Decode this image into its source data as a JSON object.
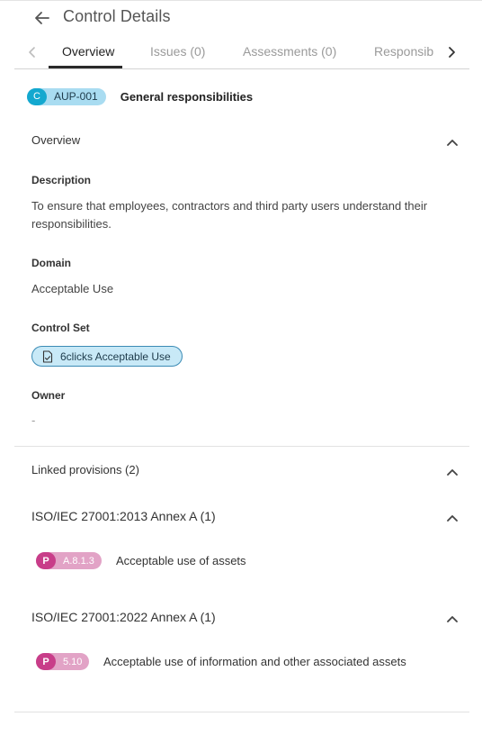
{
  "header": {
    "title": "Control Details"
  },
  "tabs": [
    {
      "label": "Overview"
    },
    {
      "label": "Issues (0)"
    },
    {
      "label": "Assessments (0)"
    },
    {
      "label": "Responsib"
    }
  ],
  "control": {
    "type_letter": "C",
    "code": "AUP-001",
    "name": "General responsibilities"
  },
  "overview": {
    "title": "Overview",
    "description_label": "Description",
    "description_line1": "To ensure that employees, contractors and third party users understand their",
    "description_line2": "responsibilities.",
    "domain_label": "Domain",
    "domain_value": "Acceptable Use",
    "control_set_label": "Control Set",
    "control_set_value": "6clicks Acceptable Use",
    "owner_label": "Owner",
    "owner_value": "-"
  },
  "linked": {
    "title": "Linked provisions (2)",
    "groups": [
      {
        "title": "ISO/IEC 27001:2013 Annex A (1)",
        "provisions": [
          {
            "letter": "P",
            "code": "A.8.1.3",
            "text": "Acceptable use of assets"
          }
        ]
      },
      {
        "title": "ISO/IEC 27001:2022 Annex A (1)",
        "provisions": [
          {
            "letter": "P",
            "code": "5.10",
            "text": "Acceptable use of information and other associated assets"
          }
        ]
      }
    ]
  },
  "colors": {
    "control_badge": "#13a8cf",
    "control_badge_light": "#a9dcf1",
    "provision_badge": "#c83d89",
    "provision_badge_light": "#e2a3c6",
    "chip_border": "#3b8bb5"
  },
  "icons": {
    "back": "arrow-left-icon",
    "tab_prev": "chevron-left-icon",
    "tab_next": "chevron-right-icon",
    "collapse": "chevron-up-icon",
    "control_set": "document-check-icon"
  }
}
